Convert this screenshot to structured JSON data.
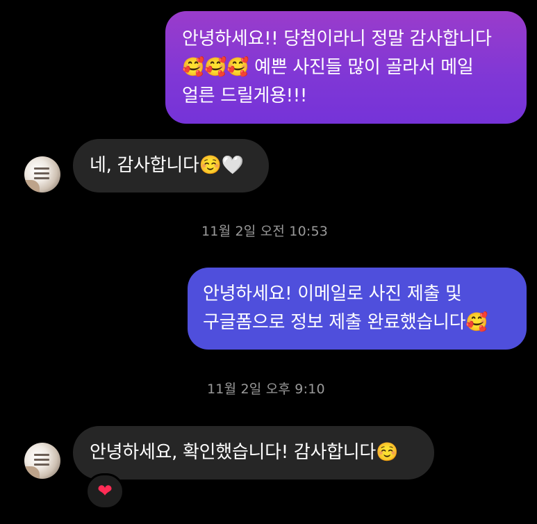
{
  "colors": {
    "background": "#000000",
    "outgoing_gradient_top": "#9a3ccb",
    "outgoing_gradient_bottom": "#7533d8",
    "outgoing_blue": "#4f4fdc",
    "incoming_bubble": "#262626",
    "timestamp_text": "#9a9a9a",
    "reaction_heart": "#ff2c55"
  },
  "messages": [
    {
      "direction": "outgoing",
      "text": "안녕하세요!! 당첨이라니 정말 감사합니다\n🥰🥰🥰 예쁜 사진들 많이 골라서 메일\n얼른 드릴게용!!!"
    },
    {
      "direction": "incoming",
      "text": "네, 감사합니다☺️🤍"
    },
    {
      "type": "timestamp",
      "text": "11월 2일 오전 10:53"
    },
    {
      "direction": "outgoing",
      "text": "안녕하세요! 이메일로 사진 제출 및\n구글폼으로 정보 제출 완료했습니다🥰"
    },
    {
      "type": "timestamp",
      "text": "11월 2일 오후 9:10"
    },
    {
      "direction": "incoming",
      "text": "안녕하세요, 확인했습니다! 감사합니다☺️",
      "reaction": "❤"
    }
  ],
  "avatar_icon": "profile-avatar"
}
